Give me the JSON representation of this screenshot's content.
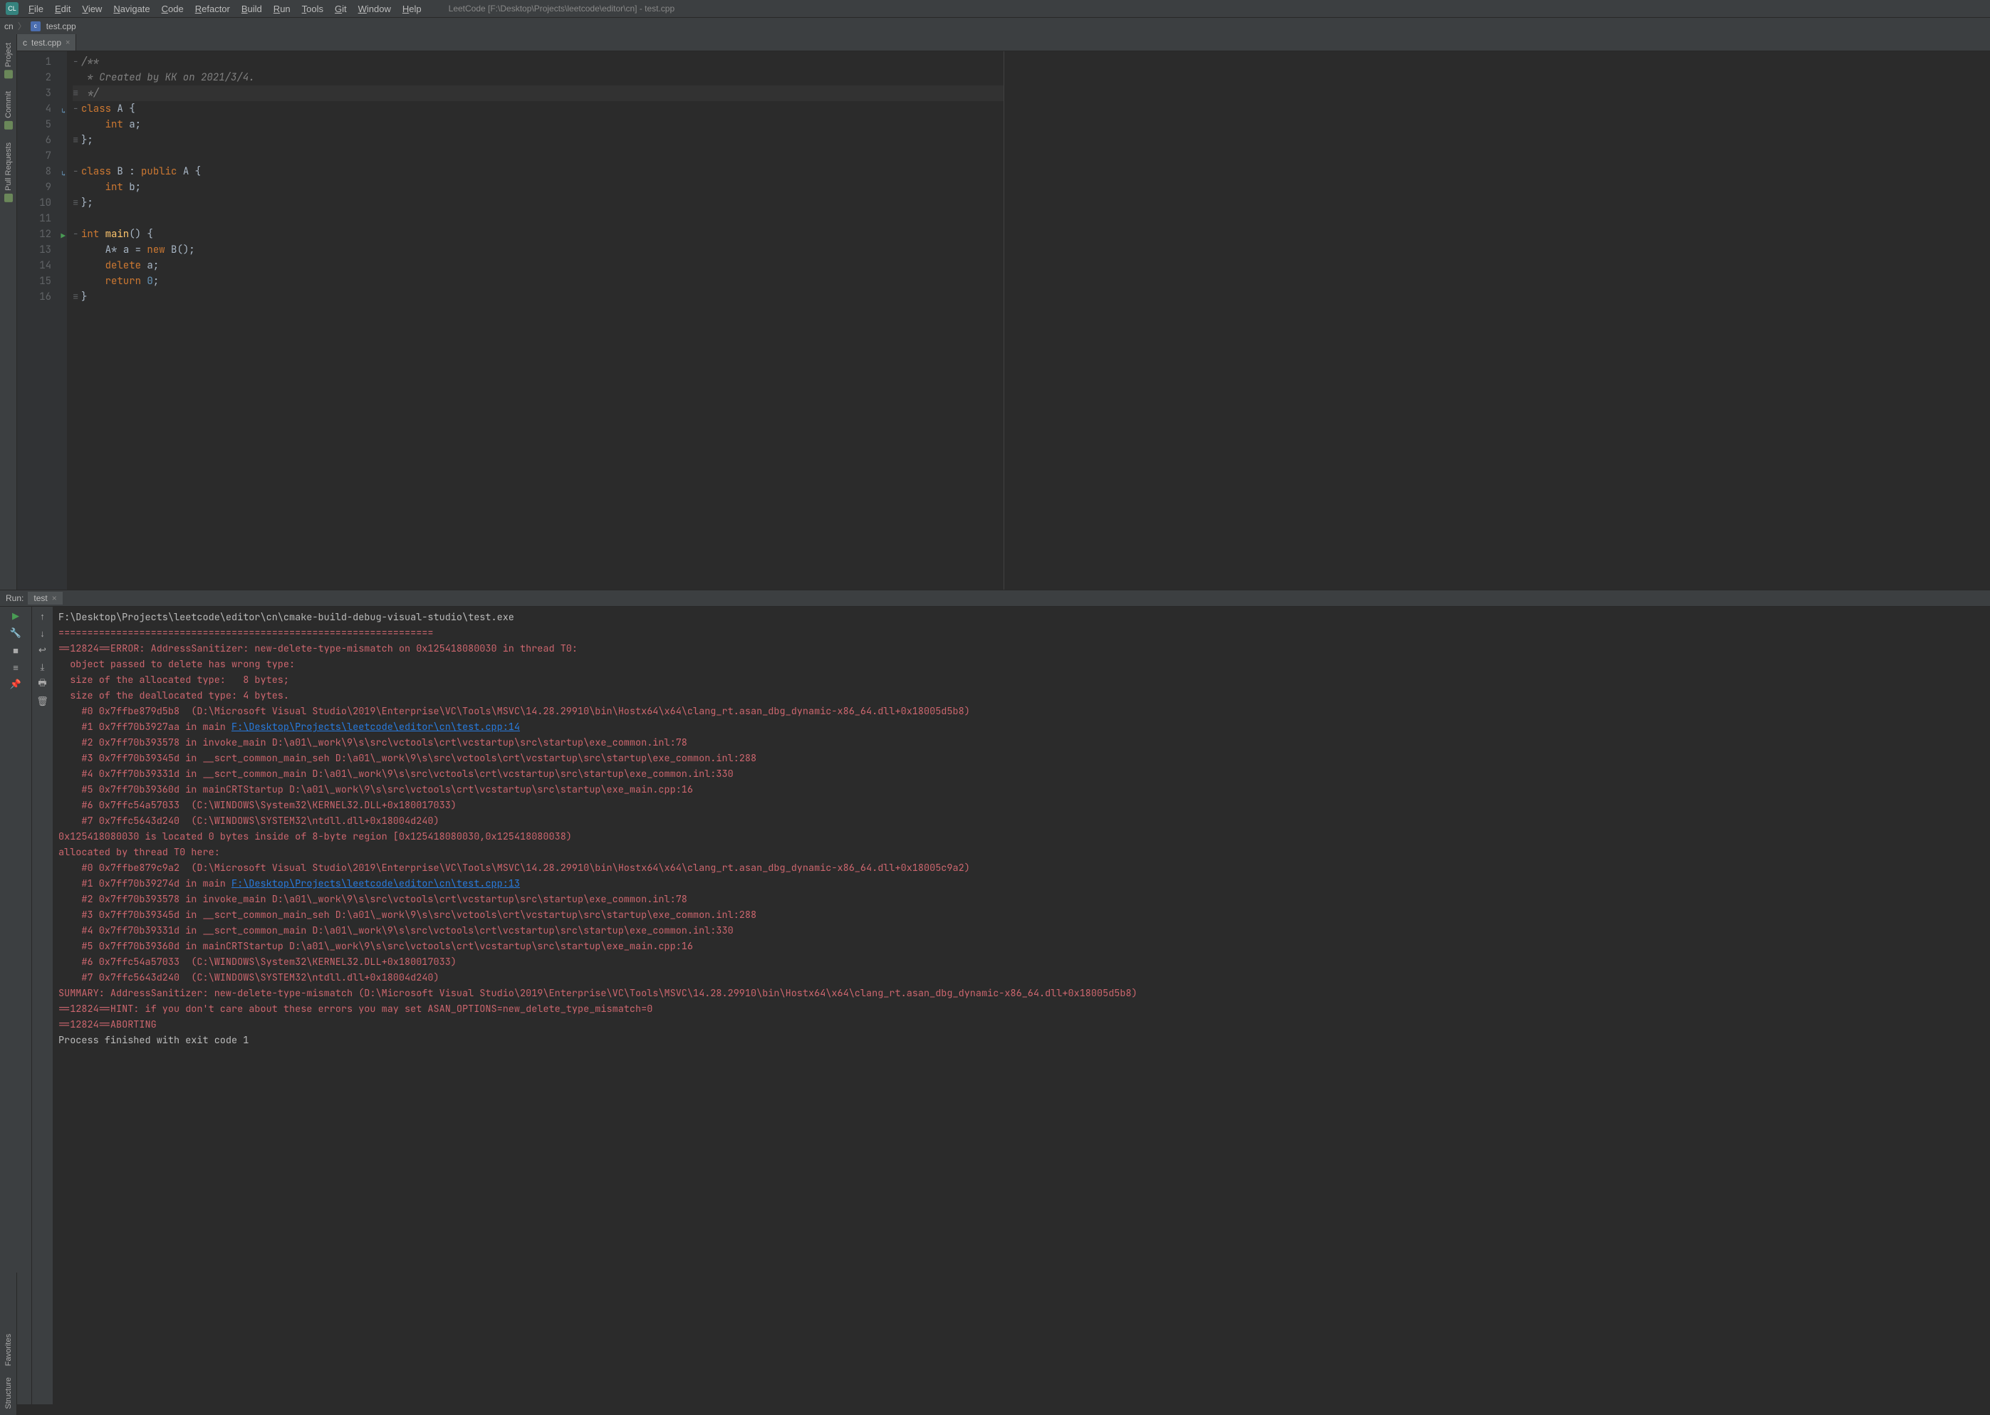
{
  "menu": {
    "items": [
      "File",
      "Edit",
      "View",
      "Navigate",
      "Code",
      "Refactor",
      "Build",
      "Run",
      "Tools",
      "Git",
      "Window",
      "Help"
    ]
  },
  "title": "LeetCode [F:\\Desktop\\Projects\\leetcode\\editor\\cn] - test.cpp",
  "crumb": {
    "root": "cn",
    "file": "test.cpp"
  },
  "left_tabs": [
    "Project",
    "Commit",
    "Pull Requests"
  ],
  "bottom_left_tabs": [
    "Structure",
    "Favorites"
  ],
  "tab": {
    "name": "test.cpp"
  },
  "code": {
    "lines": [
      {
        "n": 1,
        "tokens": [
          [
            "comment",
            "/**"
          ]
        ],
        "fold": "-"
      },
      {
        "n": 2,
        "tokens": [
          [
            "comment",
            " * Created by KK on 2021/3/4."
          ]
        ]
      },
      {
        "n": 3,
        "tokens": [
          [
            "comment",
            " */"
          ]
        ],
        "hl": true,
        "fold": "≡"
      },
      {
        "n": 4,
        "tokens": [
          [
            "key",
            "class "
          ],
          [
            "type",
            "A "
          ],
          [
            "op",
            "{"
          ]
        ],
        "fold": "-",
        "icon": "impl"
      },
      {
        "n": 5,
        "tokens": [
          [
            "plain",
            "    "
          ],
          [
            "key",
            "int "
          ],
          [
            "type",
            "a"
          ],
          [
            "op",
            ";"
          ]
        ]
      },
      {
        "n": 6,
        "tokens": [
          [
            "op",
            "};"
          ]
        ],
        "fold": "≡"
      },
      {
        "n": 7,
        "tokens": [
          [
            "plain",
            ""
          ]
        ]
      },
      {
        "n": 8,
        "tokens": [
          [
            "key",
            "class "
          ],
          [
            "type",
            "B "
          ],
          [
            "op",
            ": "
          ],
          [
            "key",
            "public "
          ],
          [
            "type",
            "A "
          ],
          [
            "op",
            "{"
          ]
        ],
        "fold": "-",
        "icon": "impl"
      },
      {
        "n": 9,
        "tokens": [
          [
            "plain",
            "    "
          ],
          [
            "key",
            "int "
          ],
          [
            "type",
            "b"
          ],
          [
            "op",
            ";"
          ]
        ]
      },
      {
        "n": 10,
        "tokens": [
          [
            "op",
            "};"
          ]
        ],
        "fold": "≡"
      },
      {
        "n": 11,
        "tokens": [
          [
            "plain",
            ""
          ]
        ]
      },
      {
        "n": 12,
        "tokens": [
          [
            "key",
            "int "
          ],
          [
            "fn",
            "main"
          ],
          [
            "op",
            "() {"
          ]
        ],
        "fold": "-",
        "icon": "run"
      },
      {
        "n": 13,
        "tokens": [
          [
            "plain",
            "    "
          ],
          [
            "type",
            "A"
          ],
          [
            "op",
            "* a = "
          ],
          [
            "new",
            "new "
          ],
          [
            "type",
            "B"
          ],
          [
            "op",
            "();"
          ]
        ]
      },
      {
        "n": 14,
        "tokens": [
          [
            "plain",
            "    "
          ],
          [
            "key",
            "delete "
          ],
          [
            "type",
            "a"
          ],
          [
            "op",
            ";"
          ]
        ]
      },
      {
        "n": 15,
        "tokens": [
          [
            "plain",
            "    "
          ],
          [
            "key",
            "return "
          ],
          [
            "num",
            "0"
          ],
          [
            "op",
            ";"
          ]
        ]
      },
      {
        "n": 16,
        "tokens": [
          [
            "op",
            "}"
          ]
        ],
        "fold": "≡"
      }
    ]
  },
  "run": {
    "label": "Run:",
    "tab": "test",
    "lines": [
      {
        "t": "plain",
        "v": "F:\\Desktop\\Projects\\leetcode\\editor\\cn\\cmake-build-debug-visual-studio\\test.exe"
      },
      {
        "t": "err",
        "v": "================================================================="
      },
      {
        "t": "err",
        "v": "==12824==ERROR: AddressSanitizer: new-delete-type-mismatch on 0x125418080030 in thread T0:"
      },
      {
        "t": "err",
        "v": "  object passed to delete has wrong type:"
      },
      {
        "t": "err",
        "v": "  size of the allocated type:   8 bytes;"
      },
      {
        "t": "err",
        "v": "  size of the deallocated type: 4 bytes."
      },
      {
        "t": "err",
        "v": "    #0 0x7ffbe879d5b8  (D:\\Microsoft Visual Studio\\2019\\Enterprise\\VC\\Tools\\MSVC\\14.28.29910\\bin\\Hostx64\\x64\\clang_rt.asan_dbg_dynamic-x86_64.dll+0x18005d5b8)"
      },
      {
        "t": "mix",
        "pre": "    #1 0x7ff70b3927aa in main ",
        "link": "F:\\Desktop\\Projects\\leetcode\\editor\\cn\\test.cpp:14"
      },
      {
        "t": "err",
        "v": "    #2 0x7ff70b393578 in invoke_main D:\\a01\\_work\\9\\s\\src\\vctools\\crt\\vcstartup\\src\\startup\\exe_common.inl:78"
      },
      {
        "t": "err",
        "v": "    #3 0x7ff70b39345d in __scrt_common_main_seh D:\\a01\\_work\\9\\s\\src\\vctools\\crt\\vcstartup\\src\\startup\\exe_common.inl:288"
      },
      {
        "t": "err",
        "v": "    #4 0x7ff70b39331d in __scrt_common_main D:\\a01\\_work\\9\\s\\src\\vctools\\crt\\vcstartup\\src\\startup\\exe_common.inl:330"
      },
      {
        "t": "err",
        "v": "    #5 0x7ff70b39360d in mainCRTStartup D:\\a01\\_work\\9\\s\\src\\vctools\\crt\\vcstartup\\src\\startup\\exe_main.cpp:16"
      },
      {
        "t": "err",
        "v": "    #6 0x7ffc54a57033  (C:\\WINDOWS\\System32\\KERNEL32.DLL+0x180017033)"
      },
      {
        "t": "err",
        "v": "    #7 0x7ffc5643d240  (C:\\WINDOWS\\SYSTEM32\\ntdll.dll+0x18004d240)"
      },
      {
        "t": "plain",
        "v": ""
      },
      {
        "t": "err",
        "v": "0x125418080030 is located 0 bytes inside of 8-byte region [0x125418080030,0x125418080038)"
      },
      {
        "t": "err",
        "v": "allocated by thread T0 here:"
      },
      {
        "t": "err",
        "v": "    #0 0x7ffbe879c9a2  (D:\\Microsoft Visual Studio\\2019\\Enterprise\\VC\\Tools\\MSVC\\14.28.29910\\bin\\Hostx64\\x64\\clang_rt.asan_dbg_dynamic-x86_64.dll+0x18005c9a2)"
      },
      {
        "t": "mix",
        "pre": "    #1 0x7ff70b39274d in main ",
        "link": "F:\\Desktop\\Projects\\leetcode\\editor\\cn\\test.cpp:13"
      },
      {
        "t": "err",
        "v": "    #2 0x7ff70b393578 in invoke_main D:\\a01\\_work\\9\\s\\src\\vctools\\crt\\vcstartup\\src\\startup\\exe_common.inl:78"
      },
      {
        "t": "err",
        "v": "    #3 0x7ff70b39345d in __scrt_common_main_seh D:\\a01\\_work\\9\\s\\src\\vctools\\crt\\vcstartup\\src\\startup\\exe_common.inl:288"
      },
      {
        "t": "err",
        "v": "    #4 0x7ff70b39331d in __scrt_common_main D:\\a01\\_work\\9\\s\\src\\vctools\\crt\\vcstartup\\src\\startup\\exe_common.inl:330"
      },
      {
        "t": "err",
        "v": "    #5 0x7ff70b39360d in mainCRTStartup D:\\a01\\_work\\9\\s\\src\\vctools\\crt\\vcstartup\\src\\startup\\exe_main.cpp:16"
      },
      {
        "t": "err",
        "v": "    #6 0x7ffc54a57033  (C:\\WINDOWS\\System32\\KERNEL32.DLL+0x180017033)"
      },
      {
        "t": "err",
        "v": "    #7 0x7ffc5643d240  (C:\\WINDOWS\\SYSTEM32\\ntdll.dll+0x18004d240)"
      },
      {
        "t": "plain",
        "v": ""
      },
      {
        "t": "err",
        "v": "SUMMARY: AddressSanitizer: new-delete-type-mismatch (D:\\Microsoft Visual Studio\\2019\\Enterprise\\VC\\Tools\\MSVC\\14.28.29910\\bin\\Hostx64\\x64\\clang_rt.asan_dbg_dynamic-x86_64.dll+0x18005d5b8)"
      },
      {
        "t": "err",
        "v": "==12824==HINT: if you don't care about these errors you may set ASAN_OPTIONS=new_delete_type_mismatch=0"
      },
      {
        "t": "err",
        "v": "==12824==ABORTING"
      },
      {
        "t": "plain",
        "v": ""
      },
      {
        "t": "plain",
        "v": "Process finished with exit code 1"
      }
    ]
  }
}
